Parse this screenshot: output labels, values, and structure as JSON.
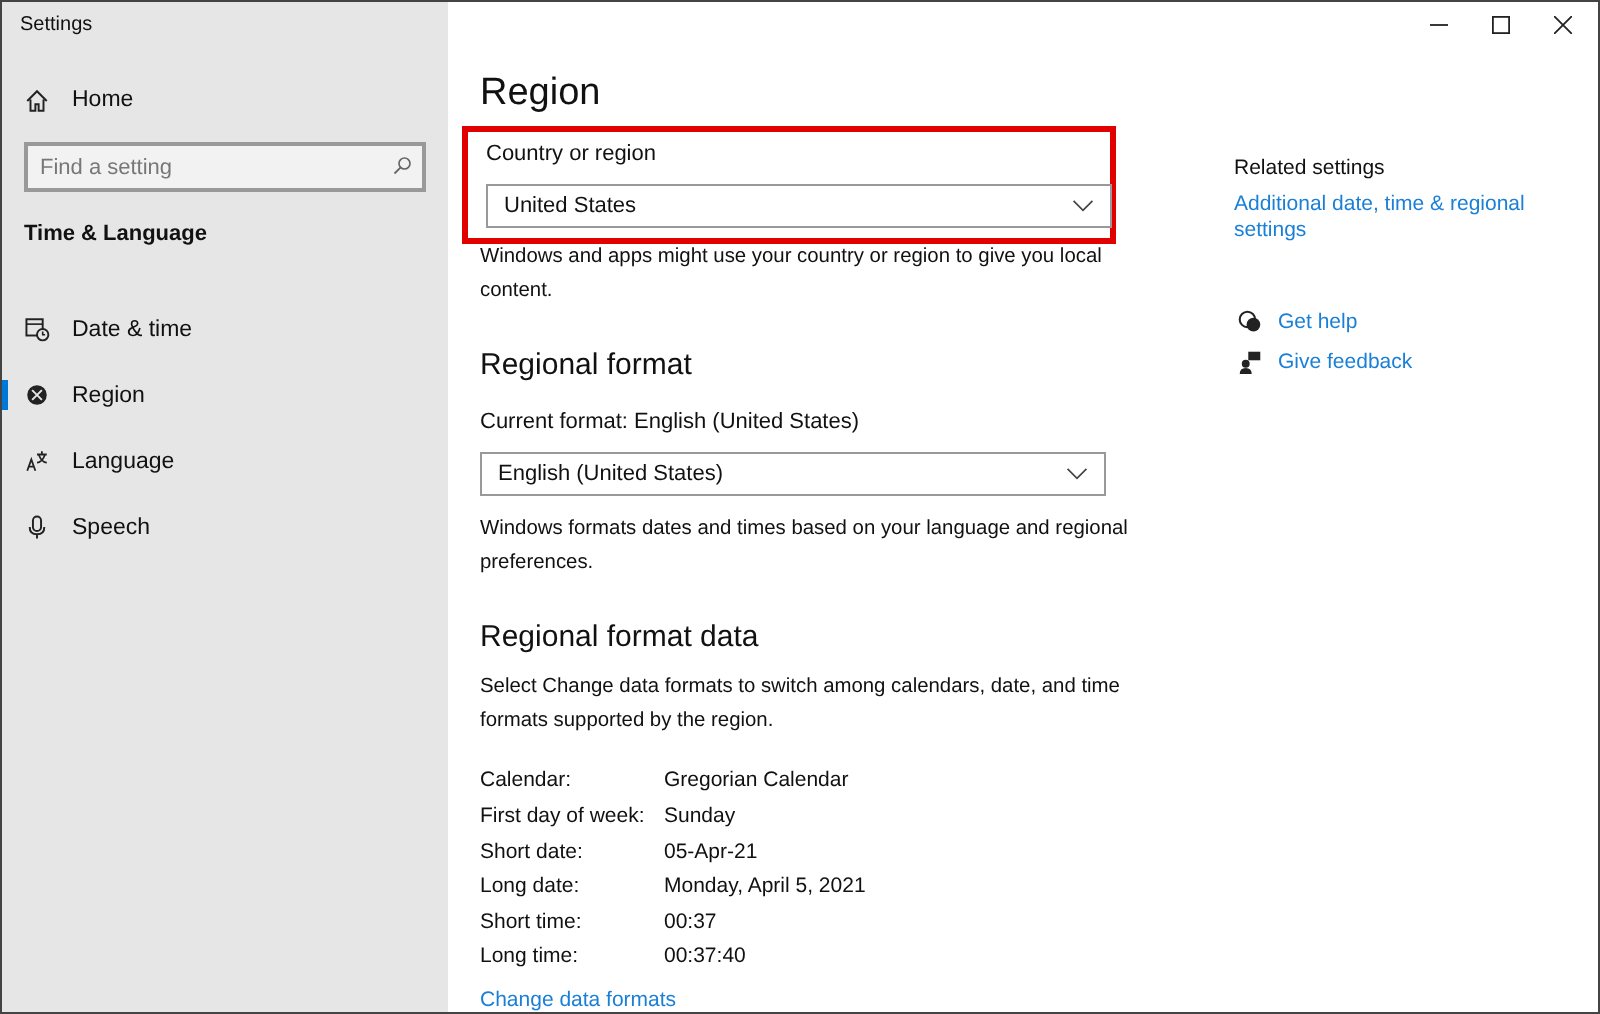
{
  "window": {
    "title": "Settings",
    "controls": [
      {
        "kind": "minimize"
      },
      {
        "kind": "maximize"
      },
      {
        "kind": "close"
      }
    ]
  },
  "sidebar": {
    "home": "Home",
    "search": {
      "placeholder": "Find a setting"
    },
    "section": "Time & Language",
    "items": [
      {
        "label": "Date & time",
        "kind": "clock",
        "selected": false
      },
      {
        "label": "Region",
        "kind": "globe",
        "selected": true
      },
      {
        "label": "Language",
        "kind": "language",
        "selected": false
      },
      {
        "label": "Speech",
        "kind": "mic",
        "selected": false
      }
    ]
  },
  "page": {
    "title": "Region",
    "country": {
      "label": "Country or region",
      "value": "United States",
      "highlighted": true,
      "description": "Windows and apps might use your country or region to give you local content."
    },
    "regional_format": {
      "heading": "Regional format",
      "label": "Current format: English (United States)",
      "value": "English (United States)",
      "description": "Windows formats dates and times based on your language and regional preferences."
    },
    "format_data": {
      "heading": "Regional format data",
      "description": "Select Change data formats to switch among calendars, date, and time formats supported by the region.",
      "rows": [
        {
          "label": "Calendar:",
          "value": "Gregorian Calendar"
        },
        {
          "label": "First day of week:",
          "value": "Sunday"
        },
        {
          "label": "Short date:",
          "value": "05-Apr-21"
        },
        {
          "label": "Long date:",
          "value": "Monday, April 5, 2021"
        },
        {
          "label": "Short time:",
          "value": "00:37"
        },
        {
          "label": "Long time:",
          "value": "00:37:40"
        }
      ],
      "link": "Change data formats"
    }
  },
  "related": {
    "heading": "Related settings",
    "link": "Additional date, time & regional settings",
    "help": [
      {
        "label": "Get help",
        "kind": "help"
      },
      {
        "label": "Give feedback",
        "kind": "feedback"
      }
    ]
  }
}
